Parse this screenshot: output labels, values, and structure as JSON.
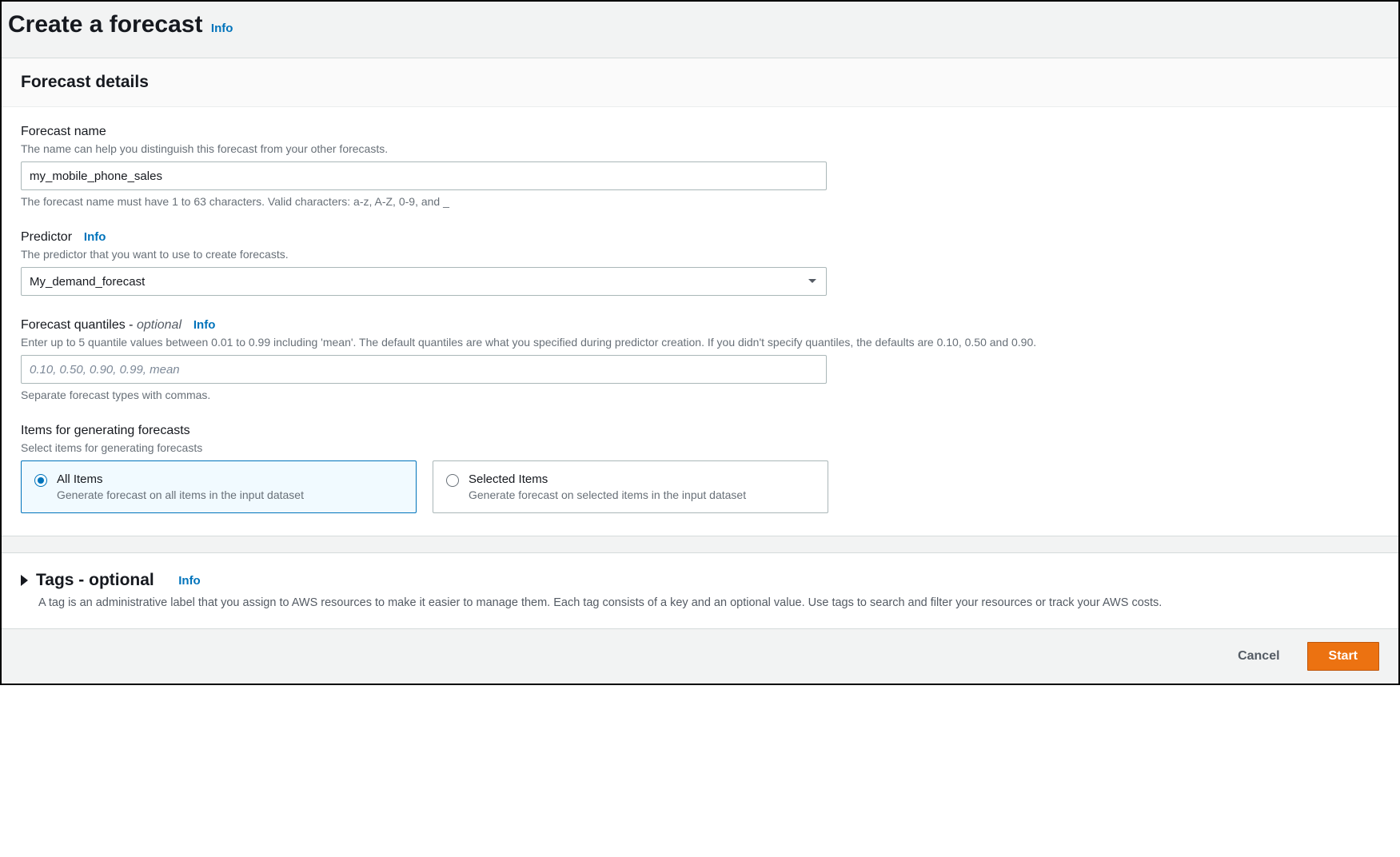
{
  "header": {
    "title": "Create a forecast",
    "info": "Info"
  },
  "details": {
    "section_title": "Forecast details",
    "forecast_name": {
      "label": "Forecast name",
      "desc": "The name can help you distinguish this forecast from your other forecasts.",
      "value": "my_mobile_phone_sales",
      "hint": "The forecast name must have 1 to 63 characters. Valid characters: a-z, A-Z, 0-9, and _"
    },
    "predictor": {
      "label": "Predictor",
      "info": "Info",
      "desc": "The predictor that you want to use to create forecasts.",
      "selected": "My_demand_forecast"
    },
    "quantiles": {
      "label": "Forecast quantiles - ",
      "optional": "optional",
      "info": "Info",
      "desc": "Enter up to 5 quantile values between 0.01 to 0.99 including 'mean'. The default quantiles are what you specified during predictor creation. If you didn't specify quantiles, the defaults are 0.10, 0.50 and 0.90.",
      "placeholder": "0.10, 0.50, 0.90, 0.99, mean",
      "hint": "Separate forecast types with commas."
    },
    "items": {
      "label": "Items for generating forecasts",
      "desc": "Select items for generating forecasts",
      "options": [
        {
          "title": "All Items",
          "desc": "Generate forecast on all items in the input dataset",
          "selected": true
        },
        {
          "title": "Selected Items",
          "desc": "Generate forecast on selected items in the input dataset",
          "selected": false
        }
      ]
    }
  },
  "tags": {
    "title": "Tags - optional",
    "info": "Info",
    "desc": "A tag is an administrative label that you assign to AWS resources to make it easier to manage them. Each tag consists of a key and an optional value. Use tags to search and filter your resources or track your AWS costs."
  },
  "footer": {
    "cancel": "Cancel",
    "start": "Start"
  }
}
